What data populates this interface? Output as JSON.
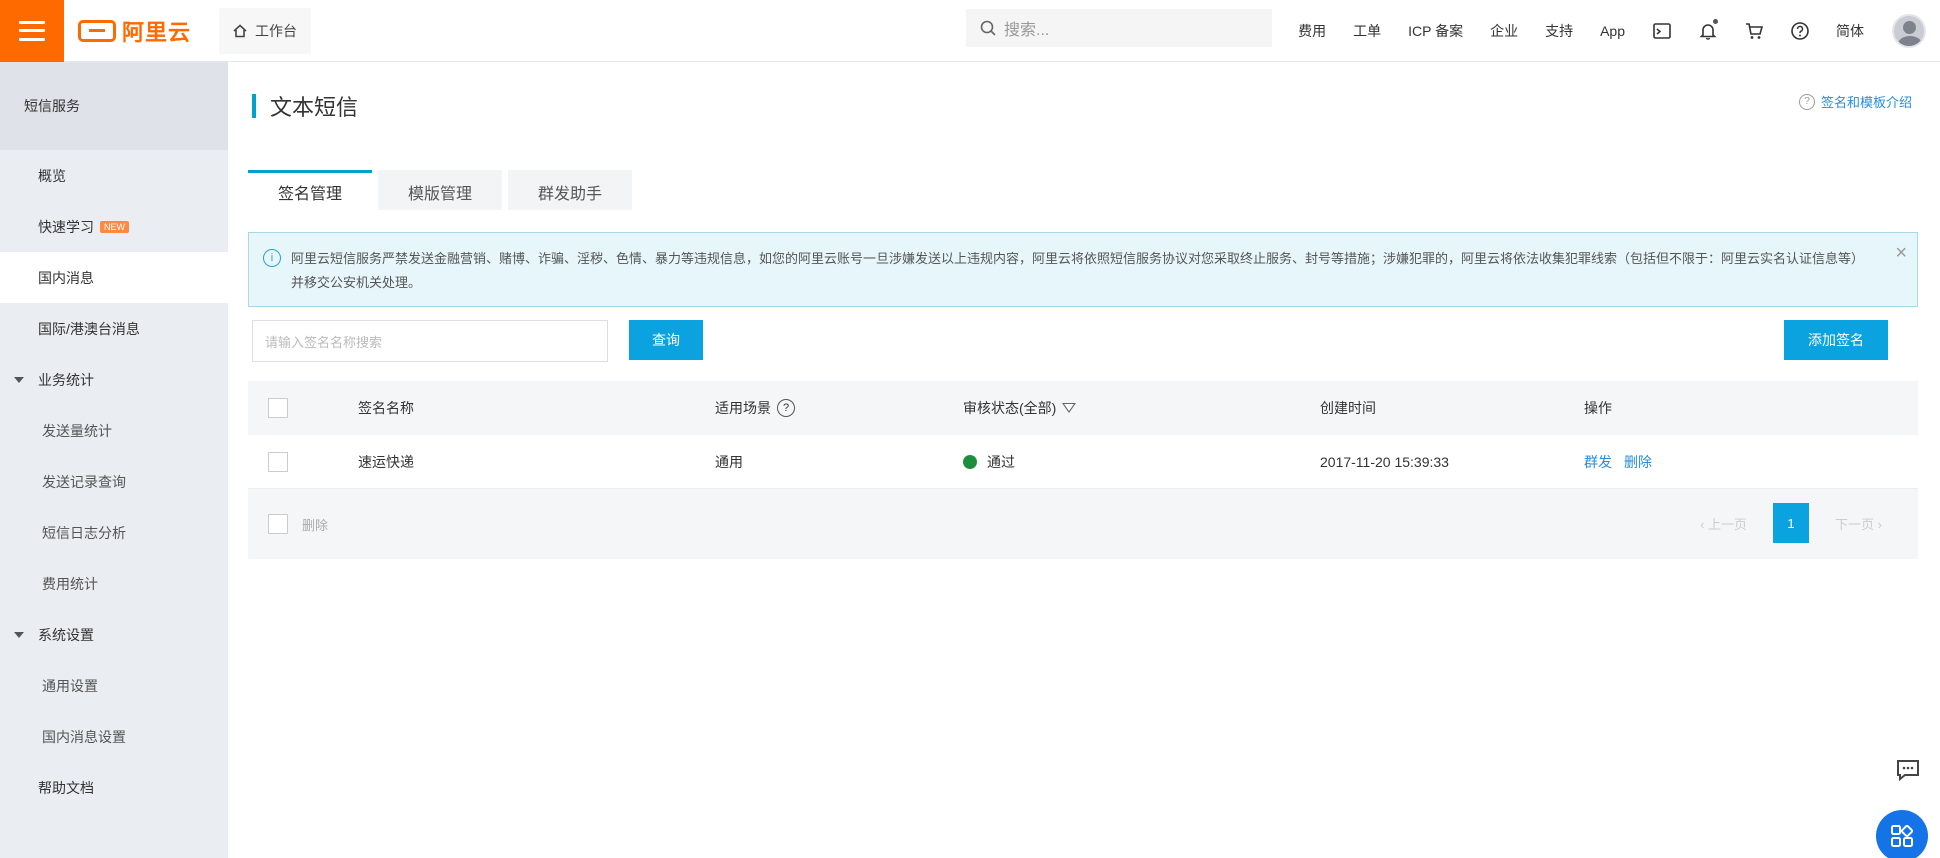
{
  "topbar": {
    "brand": "阿里云",
    "workbench": "工作台",
    "search_placeholder": "搜索...",
    "nav": [
      "费用",
      "工单",
      "ICP 备案",
      "企业",
      "支持",
      "App"
    ],
    "lang": "简体"
  },
  "sidebar": {
    "title": "短信服务",
    "items": {
      "overview": "概览",
      "quick_learn": "快速学习",
      "new_badge": "NEW",
      "domestic": "国内消息",
      "intl": "国际/港澳台消息",
      "stats_group": "业务统计",
      "send_stats": "发送量统计",
      "send_records": "发送记录查询",
      "log_analysis": "短信日志分析",
      "fee_stats": "费用统计",
      "settings_group": "系统设置",
      "general_settings": "通用设置",
      "domestic_settings": "国内消息设置",
      "help_docs": "帮助文档"
    }
  },
  "main": {
    "title": "文本短信",
    "help_link": "签名和模板介绍",
    "tabs": [
      "签名管理",
      "模版管理",
      "群发助手"
    ],
    "notice": "阿里云短信服务严禁发送金融营销、赌博、诈骗、淫秽、色情、暴力等违规信息，如您的阿里云账号一旦涉嫌发送以上违规内容，阿里云将依照短信服务协议对您采取终止服务、封号等措施；涉嫌犯罪的，阿里云将依法收集犯罪线索（包括但不限于：阿里云实名认证信息等）并移交公安机关处理。",
    "filter_placeholder": "请输入签名名称搜索",
    "query_button": "查询",
    "add_button": "添加签名",
    "table": {
      "headers": {
        "name": "签名名称",
        "scene": "适用场景",
        "status": "审核状态(全部)",
        "time": "创建时间",
        "op": "操作"
      },
      "rows": [
        {
          "name": "速运快递",
          "scene": "通用",
          "status": "通过",
          "time": "2017-11-20 15:39:33",
          "op_edit": "群发",
          "op_delete": "删除"
        }
      ],
      "bulk_delete": "删除",
      "pager": {
        "prev": "上一页",
        "current": "1",
        "next": "下一页"
      }
    }
  },
  "colors": {
    "brand_orange": "#ff6a00",
    "accent_blue": "#0aa3df",
    "link_blue": "#2a8cd9",
    "status_green": "#1e8e3e"
  }
}
